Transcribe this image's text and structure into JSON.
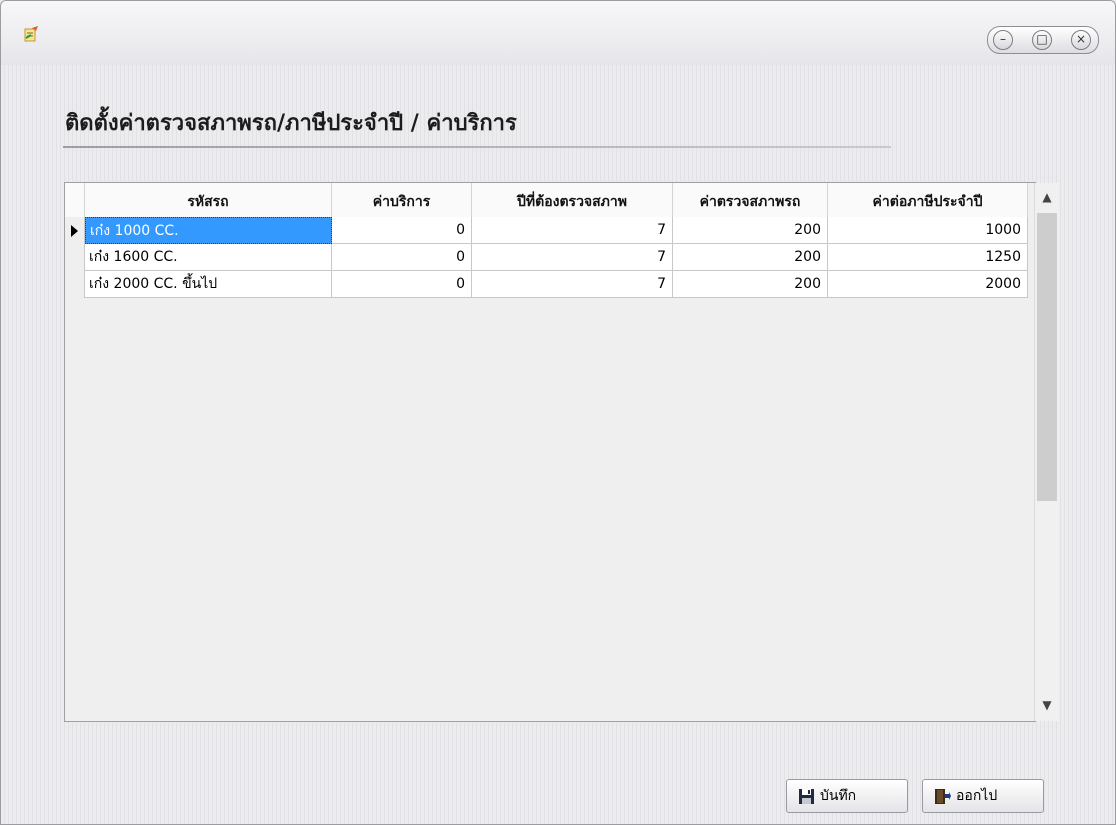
{
  "window": {
    "app_icon": "app-edit-icon",
    "buttons": {
      "minimize": "–",
      "maximize": "□",
      "close": "×"
    }
  },
  "page": {
    "title": "ติดตั้งค่าตรวจสภาพรถ/ภาษีประจำปี / ค่าบริการ"
  },
  "grid": {
    "columns": [
      "รหัสรถ",
      "ค่าบริการ",
      "ปีที่ต้องตรวจสภาพ",
      "ค่าตรวจสภาพรถ",
      "ค่าต่อภาษีประจำปี"
    ],
    "rows": [
      {
        "code": "เก๋ง 1000 CC.",
        "service_fee": "0",
        "inspect_year": "7",
        "inspect_fee": "200",
        "tax_fee": "1000",
        "selected": true
      },
      {
        "code": "เก๋ง 1600 CC.",
        "service_fee": "0",
        "inspect_year": "7",
        "inspect_fee": "200",
        "tax_fee": "1250",
        "selected": false
      },
      {
        "code": "เก๋ง 2000 CC. ขึ้นไป",
        "service_fee": "0",
        "inspect_year": "7",
        "inspect_fee": "200",
        "tax_fee": "2000",
        "selected": false
      }
    ]
  },
  "actions": {
    "save_label": "บันทึก",
    "save_icon": "floppy-disk-icon",
    "exit_label": "ออกไป",
    "exit_icon": "exit-door-icon"
  },
  "colors": {
    "selection": "#3399ff",
    "window_bg": "#e9e9ec"
  }
}
